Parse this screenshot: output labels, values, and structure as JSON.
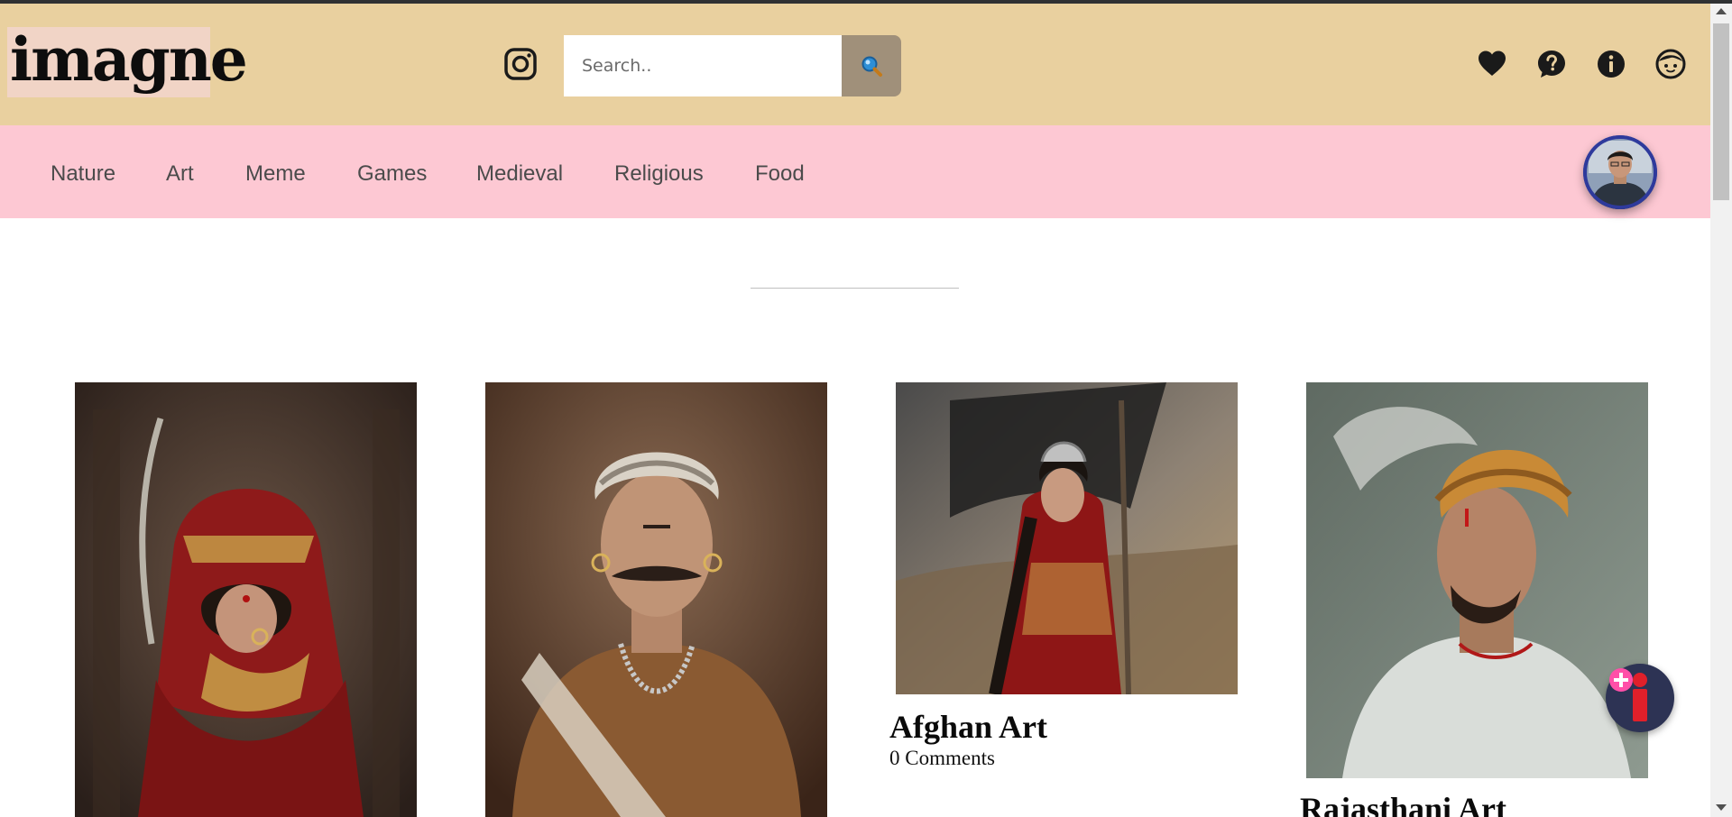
{
  "header": {
    "logo_text": "imagne",
    "search_placeholder": "Search..",
    "icons": [
      "instagram-icon",
      "search-icon",
      "heart-icon",
      "help-icon",
      "info-icon",
      "profile-icon"
    ]
  },
  "nav": {
    "categories": [
      "Nature",
      "Art",
      "Meme",
      "Games",
      "Medieval",
      "Religious",
      "Food"
    ]
  },
  "cards": [
    {
      "title": "",
      "comments": ""
    },
    {
      "title": "",
      "comments": ""
    },
    {
      "title": "Afghan Art",
      "comments": "0 Comments"
    },
    {
      "title": "Rajasthani Art",
      "comments": ""
    }
  ],
  "colors": {
    "header_bg": "#e9d09f",
    "nav_bg": "#fdc8d3",
    "logo_bg": "#f1d4c6",
    "search_button_bg": "#a0907a"
  }
}
